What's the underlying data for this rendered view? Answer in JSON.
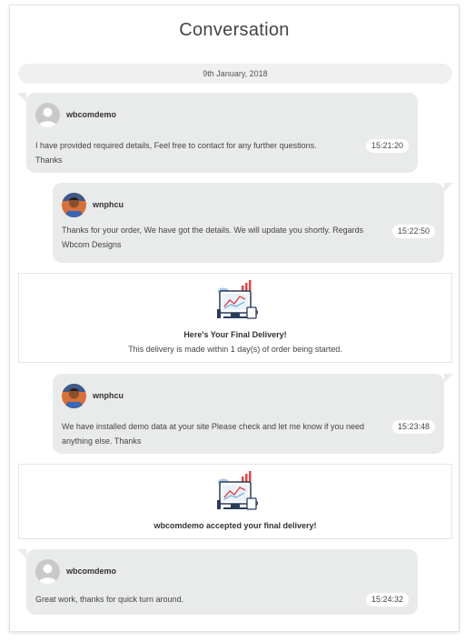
{
  "header": {
    "title": "Conversation"
  },
  "date_divider": "9th January, 2018",
  "messages": [
    {
      "user": "wbcomdemo",
      "text_line1": "I have provided required details, Feel free to contact for any further questions.",
      "text_line2": "Thanks",
      "time": "15:21:20",
      "avatar": "default-avatar-icon"
    },
    {
      "user": "wnphcu",
      "text_line1": "Thanks for your order, We have got the details. We will update you shortly. Regards",
      "text_line2": "Wbcom Designs",
      "time": "15:22:50",
      "avatar": "user-photo-avatar"
    },
    {
      "user": "wnphcu",
      "text_line1": "We have installed demo data at your site Please check and let me know if you need",
      "text_line2": "anything else. Thanks",
      "time": "15:23:48",
      "avatar": "user-photo-avatar"
    },
    {
      "user": "wbcomdemo",
      "text_line1": "Great work, thanks for quick turn around.",
      "time": "15:24:32",
      "avatar": "default-avatar-icon"
    }
  ],
  "deliveries": [
    {
      "title": "Here's Your Final Delivery!",
      "subtitle": "This delivery is made within 1 day(s) of order being started.",
      "icon": "delivery-computer-icon"
    },
    {
      "title": "wbcomdemo accepted your final delivery!",
      "icon": "delivery-computer-icon"
    }
  ],
  "colors": {
    "bubble": "#e9eaea",
    "accent_red": "#e0444a",
    "icon_navy": "#2a3b5c",
    "icon_blue": "#6fa8dc"
  }
}
